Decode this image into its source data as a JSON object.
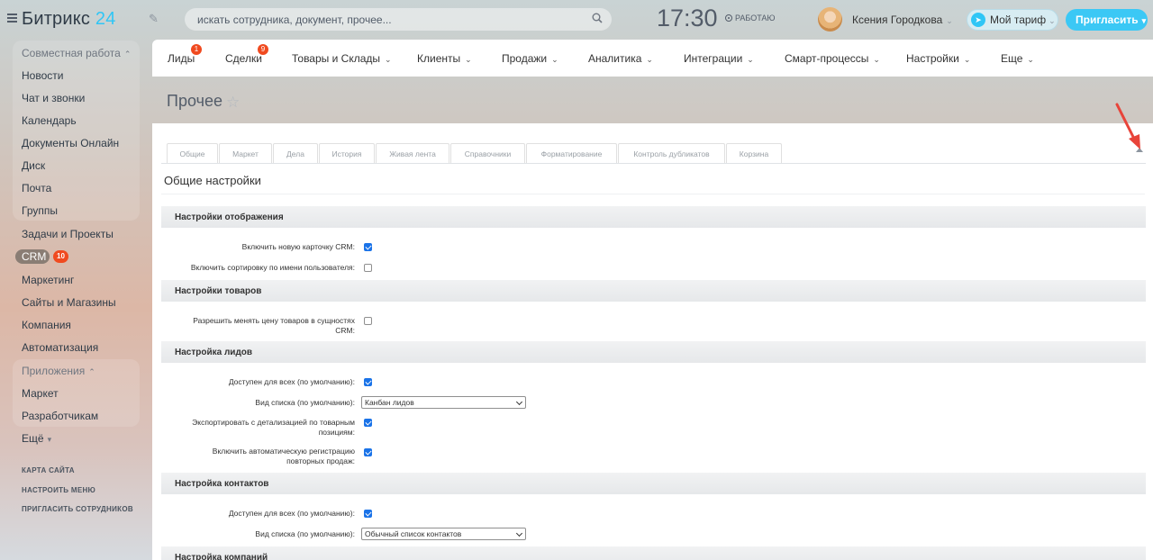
{
  "header": {
    "logo_text": "Битрикс",
    "logo_num": "24",
    "search_placeholder": "искать сотрудника, документ, прочее...",
    "clock": "17:30",
    "work_status": "РАБОТАЮ",
    "user_name": "Ксения Городкова",
    "tariff_label": "Мой тариф",
    "invite_label": "Пригласить"
  },
  "sidebar": {
    "group1_title": "Совместная работа",
    "items": [
      "Новости",
      "Чат и звонки",
      "Календарь",
      "Документы Онлайн",
      "Диск",
      "Почта",
      "Группы"
    ],
    "tasks": "Задачи и Проекты",
    "crm": "CRM",
    "crm_badge": "10",
    "items2": [
      "Маркетинг",
      "Сайты и Магазины",
      "Компания",
      "Автоматизация"
    ],
    "group2_title": "Приложения",
    "items3": [
      "Маркет",
      "Разработчикам"
    ],
    "more": "Ещё",
    "links": [
      "КАРТА САЙТА",
      "НАСТРОИТЬ МЕНЮ",
      "ПРИГЛАСИТЬ СОТРУДНИКОВ"
    ]
  },
  "crm_nav": {
    "items": [
      {
        "label": "Лиды",
        "badge": "1"
      },
      {
        "label": "Сделки",
        "badge": "9"
      },
      {
        "label": "Товары и Склады"
      },
      {
        "label": "Клиенты"
      },
      {
        "label": "Продажи"
      },
      {
        "label": "Аналитика"
      },
      {
        "label": "Интеграции"
      },
      {
        "label": "Смарт-процессы"
      },
      {
        "label": "Настройки"
      },
      {
        "label": "Еще"
      }
    ]
  },
  "page": {
    "title": "Прочее",
    "tabs": [
      "Общие",
      "Маркет",
      "Дела",
      "История",
      "Живая лента",
      "Справочники",
      "Форматирование",
      "Контроль дубликатов",
      "Корзина"
    ],
    "section_title": "Общие настройки"
  },
  "settings": {
    "display": {
      "title": "Настройки отображения",
      "new_card_label": "Включить новую карточку CRM:",
      "new_card_checked": true,
      "sort_by_name_label": "Включить сортировку по имени пользователя:",
      "sort_by_name_checked": false
    },
    "products": {
      "title": "Настройки товаров",
      "allow_price_change_label_1": "Разрешить менять цену товаров в сущностях",
      "allow_price_change_label_2": "CRM:",
      "allow_price_change_checked": false
    },
    "leads": {
      "title": "Настройка лидов",
      "available_label": "Доступен для всех (по умолчанию):",
      "available_checked": true,
      "list_view_label": "Вид списка (по умолчанию):",
      "list_view_value": "Канбан лидов",
      "export_label_1": "Экспортировать с детализацией по товарным",
      "export_label_2": "позициям:",
      "export_checked": true,
      "auto_reg_label_1": "Включить автоматическую регистрацию",
      "auto_reg_label_2": "повторных продаж:",
      "auto_reg_checked": true
    },
    "contacts": {
      "title": "Настройка контактов",
      "available_label": "Доступен для всех (по умолчанию):",
      "available_checked": true,
      "list_view_label": "Вид списка (по умолчанию):",
      "list_view_value": "Обычный список контактов"
    },
    "companies": {
      "title": "Настройка компаний"
    }
  }
}
